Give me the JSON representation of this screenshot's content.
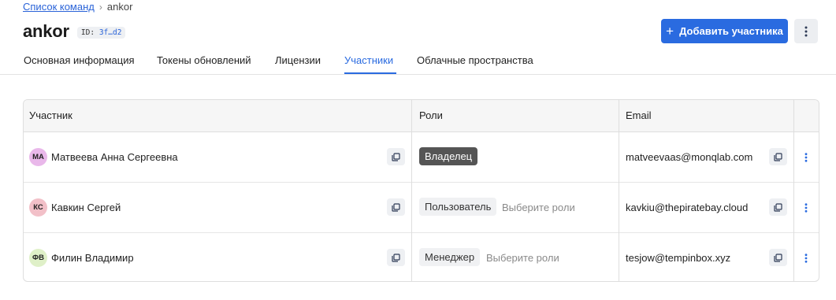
{
  "breadcrumb": {
    "link": "Список команд",
    "separator": "›",
    "current": "ankor"
  },
  "header": {
    "title": "ankor",
    "id_label": "ID:",
    "id_value": "3f…d2",
    "add_button": "Добавить участника",
    "add_button_icon": "+"
  },
  "tabs": [
    {
      "label": "Основная информация"
    },
    {
      "label": "Токены обновлений"
    },
    {
      "label": "Лицензии"
    },
    {
      "label": "Участники",
      "active": true
    },
    {
      "label": "Облачные пространства"
    }
  ],
  "table": {
    "columns": [
      "Участник",
      "Роли",
      "Email"
    ],
    "rows": [
      {
        "initials": "МА",
        "avatar_color": "#e9b8ea",
        "name": "Матвеева Анна Сергеевна",
        "role": "Владелец",
        "role_style": "dark",
        "role_placeholder": "",
        "email": "matveevaas@monqlab.com"
      },
      {
        "initials": "КС",
        "avatar_color": "#f2c0c8",
        "name": "Кавкин Сергей",
        "role": "Пользователь",
        "role_style": "light",
        "role_placeholder": "Выберите роли",
        "email": "kavkiu@thepiratebay.cloud"
      },
      {
        "initials": "ФВ",
        "avatar_color": "#dff0c8",
        "name": "Филин Владимир",
        "role": "Менеджер",
        "role_style": "light",
        "role_placeholder": "Выберите роли",
        "email": "tesjow@tempinbox.xyz"
      }
    ]
  },
  "colors": {
    "accent": "#2a6be0",
    "owner_tag": "#555555"
  }
}
